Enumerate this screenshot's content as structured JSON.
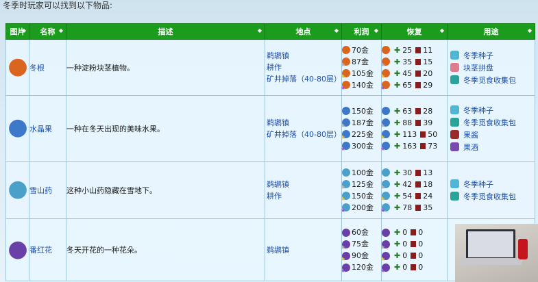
{
  "intro": "冬季时玩家可以找到以下物品:",
  "headers": [
    "图片",
    "名称",
    "描述",
    "地点",
    "利润",
    "恢复",
    "用途"
  ],
  "rows": [
    {
      "name": "冬根",
      "desc": "一种淀粉块茎植物。",
      "color": "#d9651f",
      "locations": [
        "鹈鹕镇",
        "耕作",
        "矿井掉落（40-80层）"
      ],
      "profits": [
        "70金",
        "87金",
        "105金",
        "140金"
      ],
      "restore": [
        [
          "25",
          "11"
        ],
        [
          "35",
          "15"
        ],
        [
          "45",
          "20"
        ],
        [
          "65",
          "29"
        ]
      ],
      "uses": [
        {
          "label": "冬季种子",
          "color": "#4fb6d6"
        },
        {
          "label": "块茎拼盘",
          "color": "#e07a8e"
        },
        {
          "label": "冬季觅食收集包",
          "color": "#2aa39a"
        }
      ]
    },
    {
      "name": "水晶果",
      "desc": "一种在冬天出现的美味水果。",
      "color": "#3d78c9",
      "locations": [
        "鹈鹕镇",
        "矿井掉落（40-80层）"
      ],
      "profits": [
        "150金",
        "187金",
        "225金",
        "300金"
      ],
      "restore": [
        [
          "63",
          "28"
        ],
        [
          "88",
          "39"
        ],
        [
          "113",
          "50"
        ],
        [
          "163",
          "73"
        ]
      ],
      "uses": [
        {
          "label": "冬季种子",
          "color": "#4fb6d6"
        },
        {
          "label": "冬季觅食收集包",
          "color": "#2aa39a"
        },
        {
          "label": "果酱",
          "color": "#9a2a2a"
        },
        {
          "label": "果酒",
          "color": "#7a4ab0"
        }
      ]
    },
    {
      "name": "雪山药",
      "desc": "这种小山药隐藏在雪地下。",
      "color": "#4aa0c9",
      "locations": [
        "鹈鹕镇",
        "耕作"
      ],
      "profits": [
        "100金",
        "125金",
        "150金",
        "200金"
      ],
      "restore": [
        [
          "30",
          "13"
        ],
        [
          "42",
          "18"
        ],
        [
          "54",
          "24"
        ],
        [
          "78",
          "35"
        ]
      ],
      "uses": [
        {
          "label": "冬季种子",
          "color": "#4fb6d6"
        },
        {
          "label": "冬季觅食收集包",
          "color": "#2aa39a"
        }
      ]
    },
    {
      "name": "番红花",
      "desc": "冬天开花的一种花朵。",
      "color": "#6b3fa8",
      "locations": [
        "鹈鹕镇"
      ],
      "profits": [
        "60金",
        "75金",
        "90金",
        "120金"
      ],
      "restore": [
        [
          "0",
          "0"
        ],
        [
          "0",
          "0"
        ],
        [
          "0",
          "0"
        ],
        [
          "0",
          "0"
        ]
      ],
      "uses": []
    }
  ],
  "quality_colors": [
    "",
    "#b0b0b0",
    "#e8c020",
    "#a050d8"
  ]
}
